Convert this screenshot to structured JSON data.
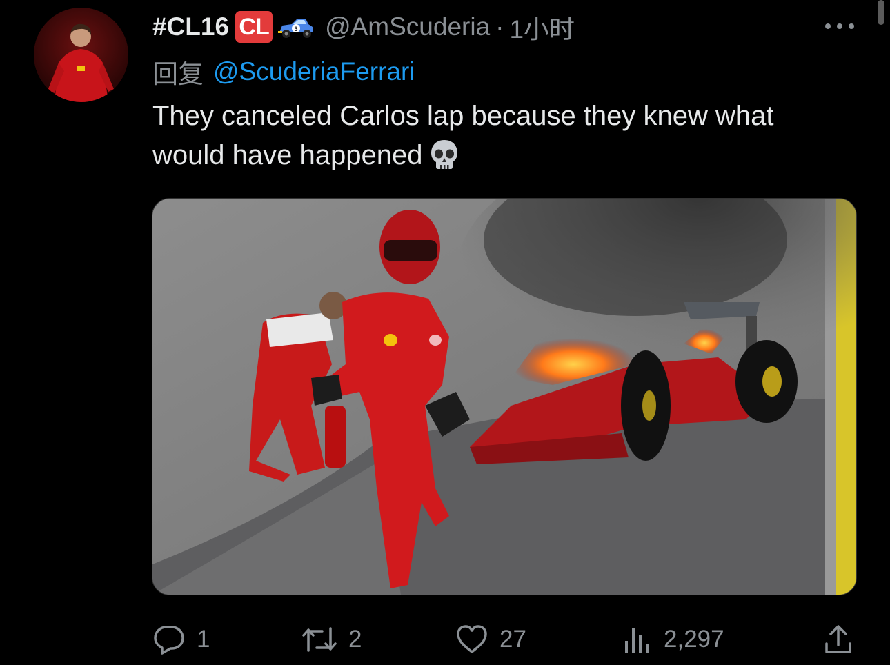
{
  "tweet": {
    "display_name": "#CL16",
    "badge_text": "CL",
    "emoji_icon": "racing-car-emoji",
    "handle": "@AmScuderia",
    "separator": "·",
    "timestamp": "1小时",
    "reply_prefix": "回复",
    "reply_to": "@ScuderiaFerrari",
    "text": "They canceled Carlos lap because they knew what would have happened",
    "text_emoji": "skull-emoji",
    "media_description_icon": "photo"
  },
  "actions": {
    "reply_count": "1",
    "retweet_count": "2",
    "like_count": "27",
    "views_count": "2,297"
  },
  "colors": {
    "background": "#000000",
    "primary_text": "#e7e9ea",
    "secondary_text": "#8b9095",
    "link": "#1d9bf0",
    "badge": "#e33b3b"
  }
}
